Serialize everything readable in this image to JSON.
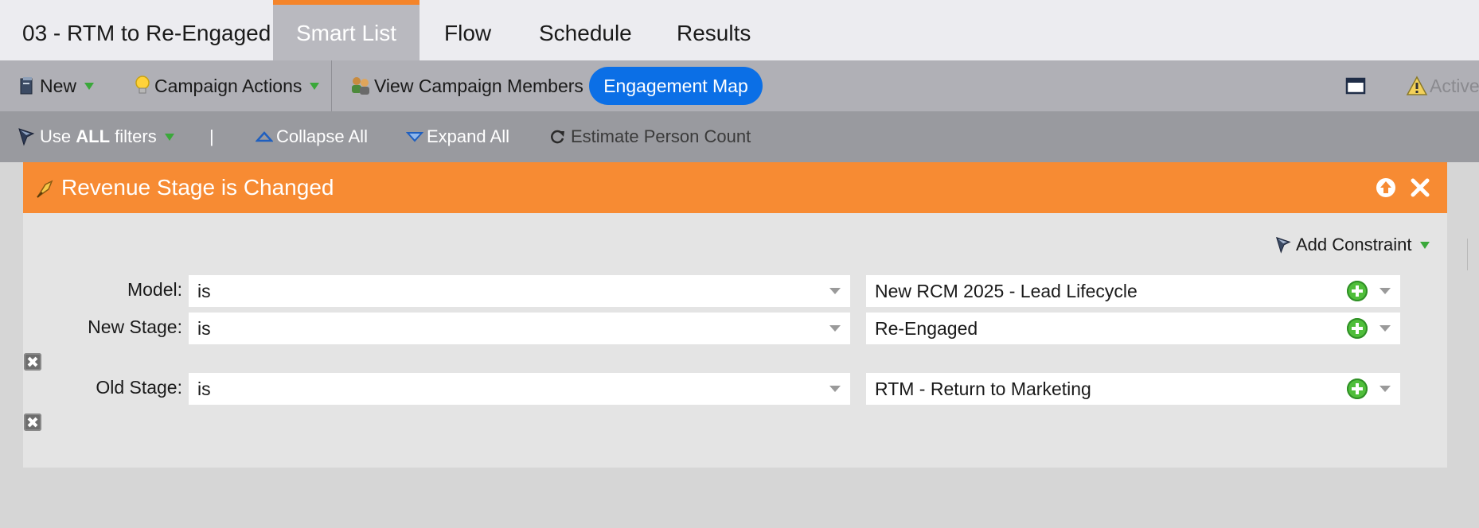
{
  "tabs": {
    "program_title": "03 - RTM to Re-Engaged",
    "smart_list": "Smart List",
    "flow": "Flow",
    "schedule": "Schedule",
    "results": "Results"
  },
  "toolbar": {
    "new_label": "New",
    "campaign_actions_label": "Campaign Actions",
    "view_members_label": "View Campaign Members",
    "engagement_map_label": "Engagement Map",
    "status_label": "Active"
  },
  "filter_toolbar": {
    "use_prefix": "Use ",
    "use_bold": "ALL",
    "use_suffix": " filters",
    "separator": "|",
    "collapse_all": "Collapse All",
    "expand_all": "Expand All",
    "estimate_count": "Estimate Person Count"
  },
  "filter": {
    "title": "Revenue Stage is Changed",
    "add_constraint_label": "Add Constraint",
    "rows": [
      {
        "label": "Model:",
        "operator": "is",
        "value": "New RCM 2025 - Lead Lifecycle"
      },
      {
        "label": "New Stage:",
        "operator": "is",
        "value": "Re-Engaged"
      },
      {
        "label": "Old Stage:",
        "operator": "is",
        "value": "RTM - Return to Marketing"
      }
    ]
  },
  "colors": {
    "tab_accent": "#f4842a",
    "filter_header": "#f78b33",
    "engagement_map_button": "#0b6fe6",
    "dropdown_arrow": "#3aa83a"
  }
}
